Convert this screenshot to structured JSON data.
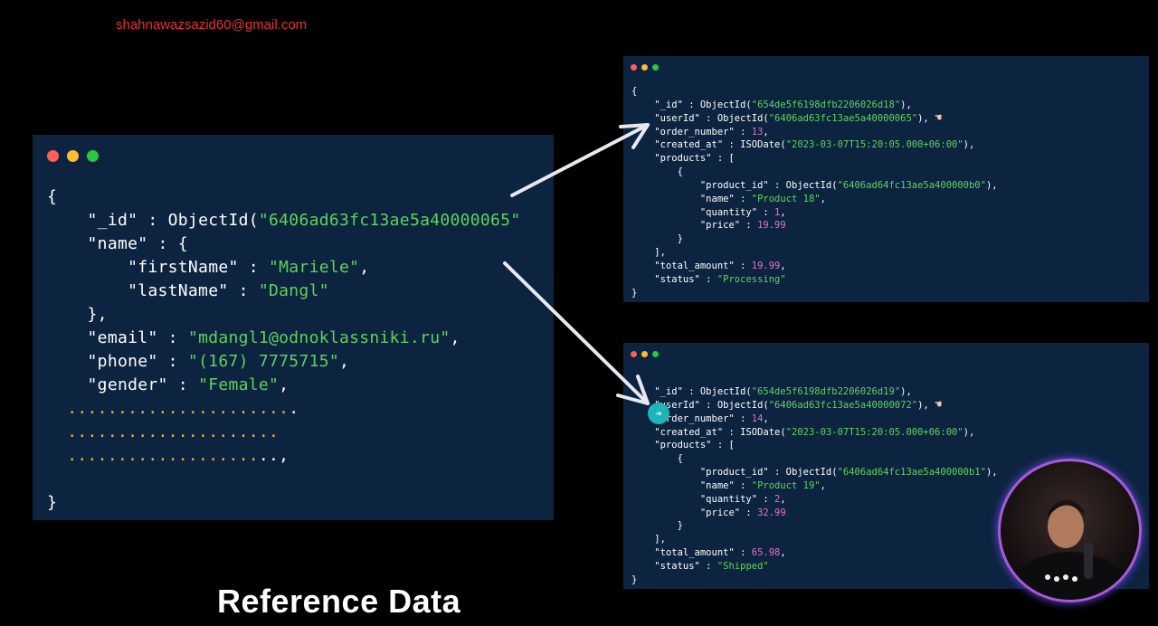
{
  "watermark": "shahnawazsazid60@gmail.com",
  "title": "Reference Data",
  "colors": {
    "panel_bg": "#0c2440",
    "key": "#ffffff",
    "string": "#5fd35a",
    "number": "#e86fd0",
    "dots_placeholder": "#f0b43c",
    "window_red": "#ff5f57",
    "window_yellow": "#febc2e",
    "window_green": "#28c840"
  },
  "icons": {
    "pointer": "hand-pointing-left-icon",
    "cursor": "arrow-right-circle-icon"
  },
  "user_doc": {
    "id": "6406ad63fc13ae5a40000065",
    "first_name": "Mariele",
    "last_name": "Dangl",
    "email": "mdangl1@odnoklassniki.ru",
    "phone": "(167) 7775715",
    "gender": "Female"
  },
  "orders": [
    {
      "id": "654de5f6198dfb2206026d18",
      "user_id": "6406ad63fc13ae5a40000065",
      "order_number": "13",
      "created_at": "2023-03-07T15:20:05.000+06:00",
      "product_id": "6406ad64fc13ae5a400000b0",
      "product_name": "Product 18",
      "quantity": "1",
      "price": "19.99",
      "total_amount": "19.99",
      "status": "Processing"
    },
    {
      "id": "654de5f6198dfb2206026d19",
      "user_id": "6406ad63fc13ae5a40000072",
      "order_number": "14",
      "created_at": "2023-03-07T15:20:05.000+06:00",
      "product_id": "6406ad64fc13ae5a400000b1",
      "product_name": "Product 19",
      "quantity": "2",
      "price": "32.99",
      "total_amount": "65.98",
      "status": "Shipped"
    }
  ]
}
